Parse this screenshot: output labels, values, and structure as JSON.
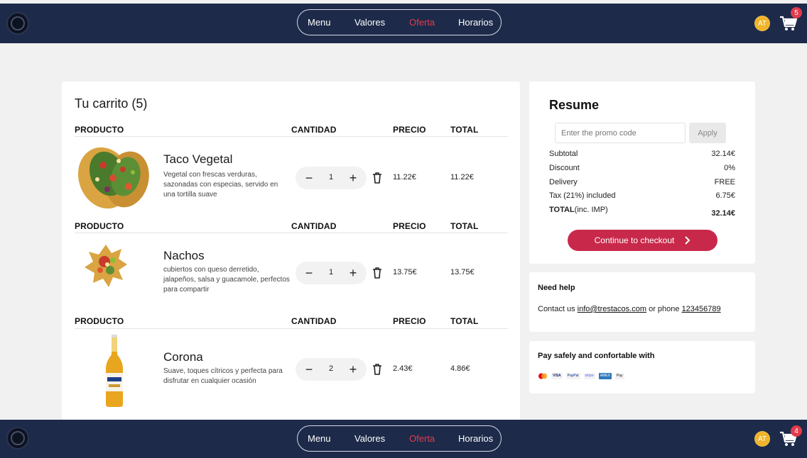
{
  "nav": {
    "links": [
      "Menu",
      "Valores",
      "Oferta",
      "Horarios"
    ],
    "active": "Oferta",
    "avatar_initials": "AT",
    "cart_count_top": "5",
    "cart_count_bottom": "4"
  },
  "cart": {
    "title": "Tu carrito (5)",
    "headers": {
      "product": "PRODUCTO",
      "quantity": "CANTIDAD",
      "price": "PRECIO",
      "total": "TOTAL"
    },
    "items": [
      {
        "name": "Taco Vegetal",
        "description": "Vegetal con frescas verduras, sazonadas con especias, servido en una tortilla suave",
        "quantity": "1",
        "price": "11.22€",
        "total": "11.22€",
        "image_icon": "taco-icon"
      },
      {
        "name": "Nachos",
        "description": "cubiertos con queso derretido, jalapeños, salsa y guacamole, perfectos para compartir",
        "quantity": "1",
        "price": "13.75€",
        "total": "13.75€",
        "image_icon": "nachos-icon"
      },
      {
        "name": "Corona",
        "description": "Suave, toques cítricos y perfecta para disfrutar en cualquier ocasión",
        "quantity": "2",
        "price": "2.43€",
        "total": "4.86€",
        "image_icon": "beer-bottle-icon"
      }
    ]
  },
  "resume": {
    "title": "Resume",
    "promo_placeholder": "Enter the promo code",
    "apply_label": "Apply",
    "rows": [
      {
        "label": "Subtotal",
        "value": "32.14€"
      },
      {
        "label": "Discount",
        "value": "0%"
      },
      {
        "label": "Delivery",
        "value": "FREE"
      },
      {
        "label": "Tax (21%) included",
        "value": "6.75€"
      }
    ],
    "total_label": "TOTAL",
    "total_suffix": "(inc. IMP)",
    "total_value": "32.14€",
    "checkout_label": "Continue to checkout"
  },
  "help": {
    "title": "Need help",
    "contact_prefix": "Contact us ",
    "email": "info@trestacos.com",
    "phone_prefix": " or phone ",
    "phone": "123456789"
  },
  "payment": {
    "title": "Pay safely and confortable with",
    "methods": [
      "VISA",
      "PayPal",
      "stripe",
      "AMEX",
      "Pay"
    ]
  },
  "colors": {
    "navbar": "#1d2a4a",
    "accent": "#e23b4c",
    "checkout": "#c8294a",
    "avatar": "#f0b429"
  }
}
